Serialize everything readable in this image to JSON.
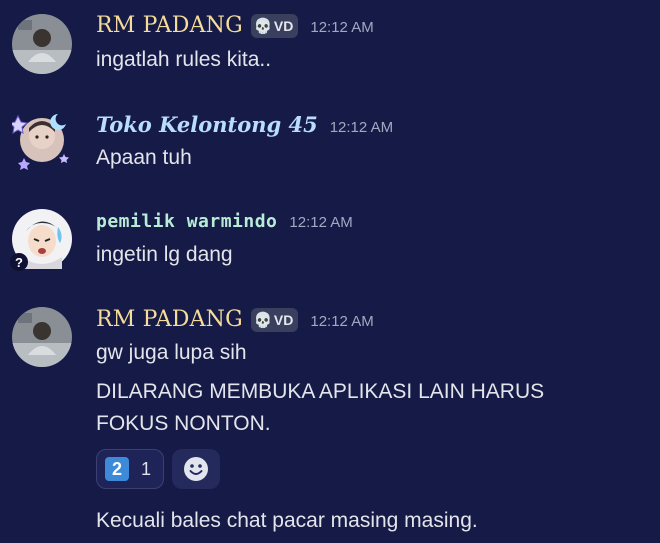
{
  "messages": [
    {
      "username": "RM PADANG",
      "tag": {
        "icon": "skull-icon",
        "label": "VD"
      },
      "time": "12:12 AM",
      "lines": [
        "ingatlah rules kita.."
      ]
    },
    {
      "username": "Toko Kelontong 45",
      "time": "12:12 AM",
      "lines": [
        "Apaan tuh"
      ]
    },
    {
      "username": "pemilik warmindo",
      "time": "12:12 AM",
      "lines": [
        "ingetin lg dang"
      ]
    },
    {
      "username": "RM PADANG",
      "tag": {
        "icon": "skull-icon",
        "label": "VD"
      },
      "time": "12:12 AM",
      "lines": [
        "gw juga lupa sih",
        "DILARANG MEMBUKA APLIKASI LAIN HARUS",
        "FOKUS NONTON.",
        "Kecuali bales chat pacar masing masing."
      ],
      "reaction": {
        "emoji": "2",
        "count": "1"
      }
    }
  ],
  "colors": {
    "background": "#161a47",
    "rm_padang_name": "#f5dc9a",
    "toko_name": "#b9ddff",
    "pemilik_name": "#b9ecd6",
    "timestamp": "#a3a8c2",
    "keycap": "#3d8ad8"
  }
}
